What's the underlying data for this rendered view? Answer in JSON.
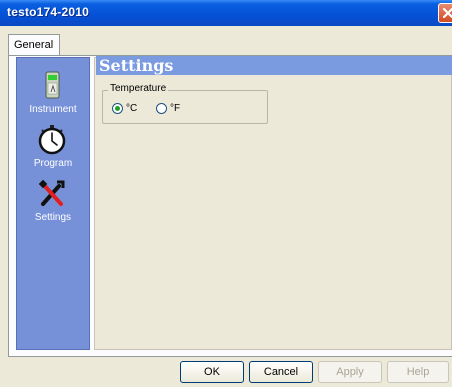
{
  "window": {
    "title": "testo174-2010"
  },
  "tabs": [
    {
      "label": "General",
      "active": true
    }
  ],
  "sidebar": {
    "items": [
      {
        "label": "Instrument",
        "icon": "instrument-device-icon"
      },
      {
        "label": "Program",
        "icon": "stopwatch-icon"
      },
      {
        "label": "Settings",
        "icon": "tools-icon"
      }
    ]
  },
  "section": {
    "title": "Settings"
  },
  "temperature": {
    "group_label": "Temperature",
    "options": [
      {
        "label": "°C",
        "checked": true
      },
      {
        "label": "°F",
        "checked": false
      }
    ]
  },
  "buttons": {
    "ok": "OK",
    "cancel": "Cancel",
    "apply": "Apply",
    "help": "Help"
  },
  "colors": {
    "sidebar": "#7791d8",
    "header": "#7b9be0",
    "titlebar": "#0551d6",
    "radio_checked": "#21a121"
  }
}
